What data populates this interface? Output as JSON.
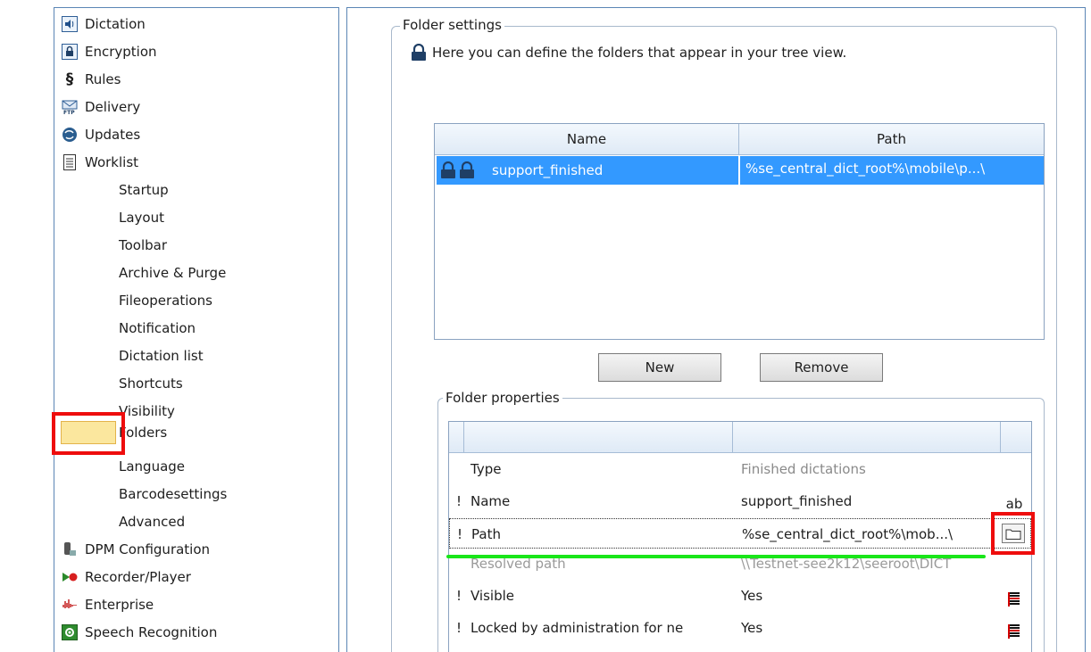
{
  "tree": {
    "items": [
      {
        "label": "Dictation",
        "icon": "speaker-icon"
      },
      {
        "label": "Encryption",
        "icon": "padlock-icon"
      },
      {
        "label": "Rules",
        "icon": "section-sign-icon"
      },
      {
        "label": "Delivery",
        "icon": "ftp-mail-icon"
      },
      {
        "label": "Updates",
        "icon": "globe-update-icon"
      },
      {
        "label": "Worklist",
        "icon": "document-list-icon"
      }
    ],
    "worklist_children": [
      "Startup",
      "Layout",
      "Toolbar",
      "Archive & Purge",
      "Fileoperations",
      "Notification",
      "Dictation list",
      "Shortcuts",
      "Visibility",
      "Folders",
      "Language",
      "Barcodesettings",
      "Advanced"
    ],
    "selected": "Folders",
    "bottom_items": [
      {
        "label": "DPM Configuration",
        "icon": "dpm-device-icon"
      },
      {
        "label": "Recorder/Player",
        "icon": "recorder-player-icon"
      },
      {
        "label": "Enterprise",
        "icon": "waveform-icon"
      },
      {
        "label": "Speech Recognition",
        "icon": "gear-box-icon"
      }
    ]
  },
  "folder_settings": {
    "title": "Folder settings",
    "description": "Here you can define the folders that appear in your tree view.",
    "columns": [
      "Name",
      "Path"
    ],
    "rows": [
      {
        "name": "support_finished",
        "path": "%se_central_dict_root%\\mobile\\p...\\"
      }
    ],
    "new_button": "New",
    "remove_button": "Remove"
  },
  "folder_properties": {
    "title": "Folder properties",
    "rows": [
      {
        "prefix": "",
        "label": "Type",
        "value": "Finished dictations",
        "right": ""
      },
      {
        "prefix": "!",
        "label": "Name",
        "value": "support_finished",
        "right": "ab"
      },
      {
        "prefix": "!",
        "label": "Path",
        "value": "%se_central_dict_root%\\mob...\\",
        "right": ""
      },
      {
        "prefix": "",
        "label": "Resolved path",
        "value": "\\\\Testnet-see2k12\\seeroot\\DICT",
        "right": ""
      },
      {
        "prefix": "!",
        "label": "Visible",
        "value": "Yes",
        "right": ""
      },
      {
        "prefix": "!",
        "label": "Locked by administration for ne",
        "value": "Yes",
        "right": ""
      }
    ]
  },
  "colors": {
    "highlight_red": "#ee0d0d",
    "annotation_green": "#19e619",
    "selection_blue": "#3399ff"
  }
}
